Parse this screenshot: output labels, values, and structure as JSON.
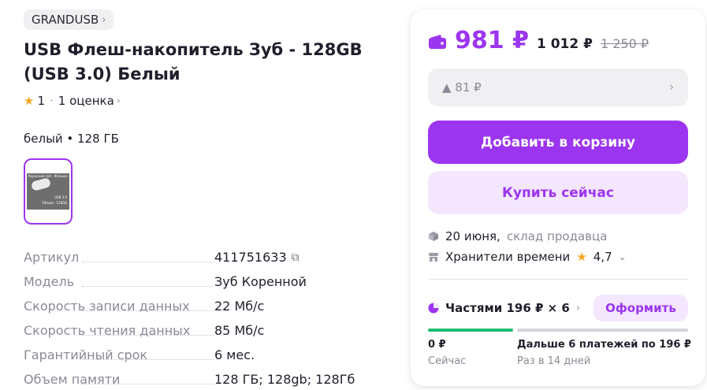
{
  "brand": {
    "label": "GRANDUSB",
    "chevron": "›"
  },
  "product": {
    "title": "USB Флеш-накопитель Зуб - 128GB (USB 3.0) Белый",
    "rating_value": "1",
    "rating_sep": "·",
    "rating_count": "1 оценка",
    "rating_chevron": "›",
    "variant": "белый • 128 ГБ",
    "thumbnail": {
      "caption_top": "Коренной зуб - Флешка",
      "caption_mid": "USB 3.0",
      "caption_bottom": "Объем - 128GB"
    }
  },
  "specs": [
    {
      "label": "Артикул",
      "value": "411751633",
      "copy": true
    },
    {
      "label": "Модель",
      "value": "Зуб Коренной"
    },
    {
      "label": "Скорость записи данных",
      "value": "22 Мб/с"
    },
    {
      "label": "Скорость чтения данных",
      "value": "85 Мб/с"
    },
    {
      "label": "Гарантийный срок",
      "value": "6 мес."
    },
    {
      "label": "Объем памяти",
      "value": "128 ГБ; 128gb; 128Гб"
    }
  ],
  "buy": {
    "price_wallet": "981 ₽",
    "price_regular": "1 012 ₽",
    "price_old": "1 250 ₽",
    "bonus": "▲ 81 ₽",
    "add_to_cart": "Добавить в корзину",
    "buy_now": "Купить сейчас",
    "delivery_date": "20 июня,",
    "delivery_source": "склад продавца",
    "seller_name": "Хранители времени",
    "seller_rating": "4,7",
    "installments_label": "Частями 196 ₽ × 6",
    "checkout": "Оформить",
    "pay_now_amount": "0 ₽",
    "pay_now_label": "Сейчас",
    "pay_later_amount": "Дальше 6 платежей по 196 ₽",
    "pay_later_label": "Раз в 14 дней"
  },
  "colors": {
    "accent": "#9c35f0",
    "accent_light": "#f3e6fd",
    "progress_now": "#1dbf73",
    "star": "#f5a623"
  },
  "installment_progress_fraction": 0
}
